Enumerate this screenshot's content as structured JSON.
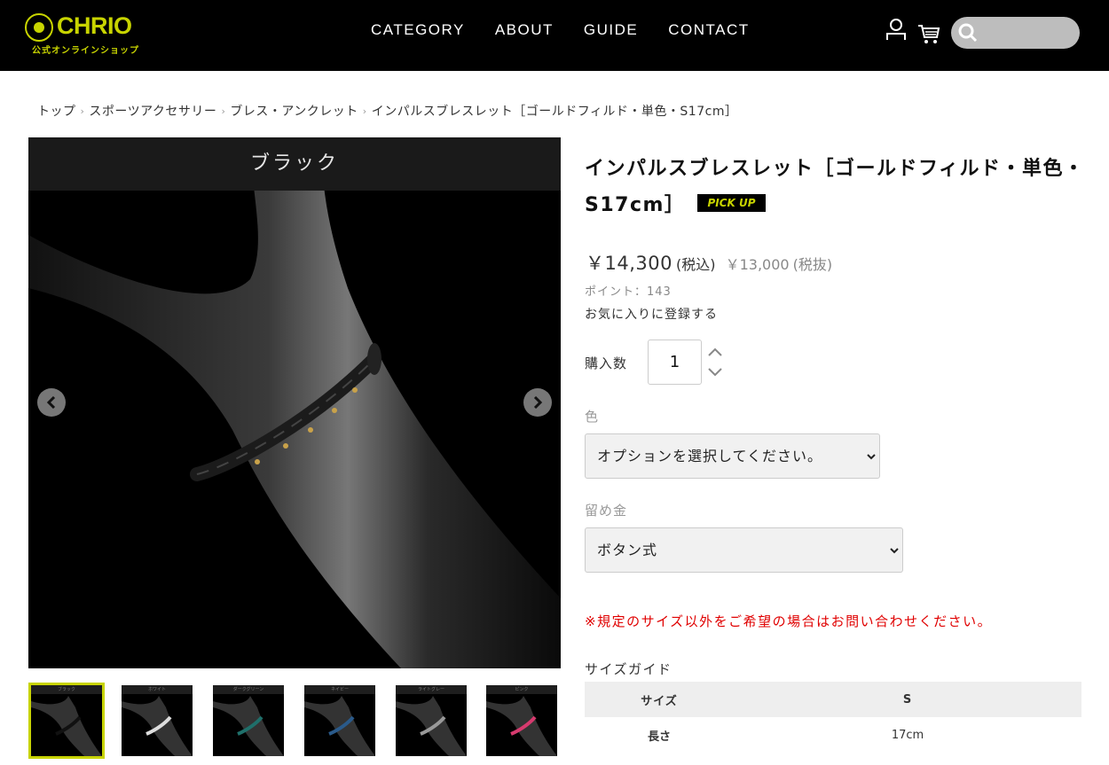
{
  "header": {
    "logo_word": "CHRIO",
    "logo_sub": "公式オンラインショップ",
    "nav": [
      "CATEGORY",
      "ABOUT",
      "GUIDE",
      "CONTACT"
    ],
    "icons": [
      "user-icon",
      "cart-icon",
      "search-icon"
    ],
    "search_placeholder": ""
  },
  "breadcrumb": [
    "トップ",
    "スポーツアクセサリー",
    "ブレス・アンクレット",
    "インパルスブレスレット［ゴールドフィルド・単色・S17cm］"
  ],
  "gallery": {
    "banner": "ブラック",
    "thumb_labels": [
      "ブラック",
      "ホワイト",
      "ダークグリーン",
      "ネイビー",
      "ライトグレー",
      "ピンク"
    ]
  },
  "product": {
    "title": "インパルスブレスレット［ゴールドフィルド・単色・S17cm］",
    "badge": "PICK UP",
    "price_incl": "￥14,300",
    "price_incl_note": "(税込)",
    "price_excl": "￥13,000",
    "price_excl_note": "(税抜)",
    "points": "ポイント：143",
    "favorite": "お気に入りに登録する",
    "qty_label": "購入数",
    "qty_value": "1",
    "color_label": "色",
    "color_select": "オプションを選択してください。",
    "clasp_label": "留め金",
    "clasp_select": "ボタン式",
    "notice": "※規定のサイズ以外をご希望の場合はお問い合わせください。",
    "size_guide": "サイズガイド"
  },
  "size_table": {
    "headers": [
      "サイズ",
      "S"
    ],
    "rows": [
      [
        "長さ",
        "17cm"
      ]
    ]
  },
  "colors": {
    "accent": "#c8d400",
    "notice": "#e00000",
    "header_bg": "#000000"
  }
}
